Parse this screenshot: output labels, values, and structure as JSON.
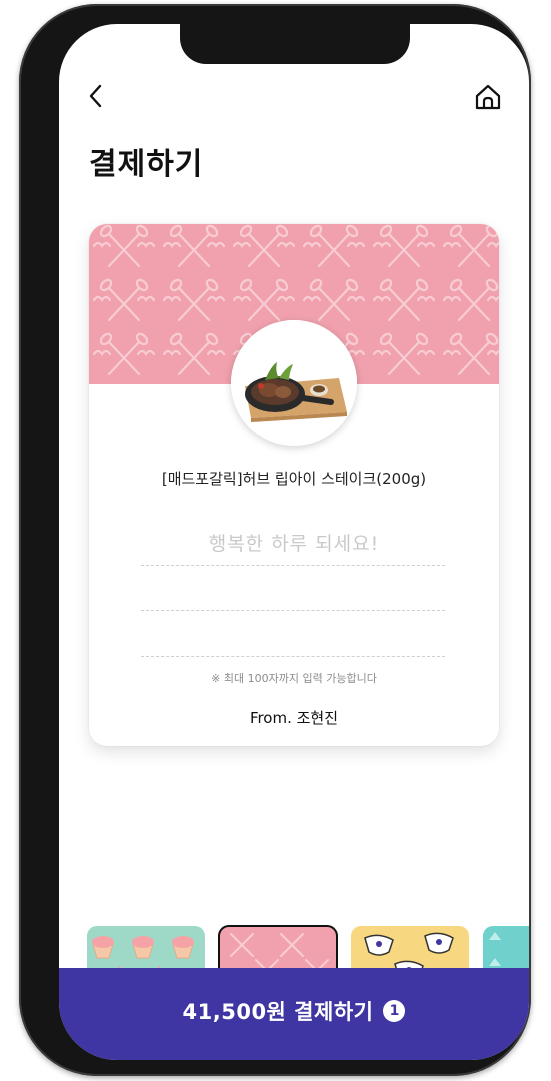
{
  "header": {
    "back_icon": "chevron-left-icon",
    "home_icon": "home-icon"
  },
  "page": {
    "title": "결제하기"
  },
  "card": {
    "theme_color": "#f0a1ad",
    "pattern_color": "#f7c7cf",
    "product_name": "[매드포갈릭]허브 립아이 스테이크(200g)",
    "message_placeholder": "행복한 하루 되세요!",
    "limit_note": "※ 최대 100자까지 입력 가능합니다",
    "from_label": "From. 조현진"
  },
  "themes": [
    {
      "name": "cupcake",
      "color": "#9ed9c7",
      "selected": false
    },
    {
      "name": "pink-whisk",
      "color": "#f0a1ad",
      "selected": true
    },
    {
      "name": "yellow-cup",
      "color": "#f7d77f",
      "selected": false
    },
    {
      "name": "teal-pattern",
      "color": "#6fd0cc",
      "selected": false
    }
  ],
  "pay_button": {
    "label": "41,500원 결제하기",
    "badge": "1",
    "color": "#3f35a3"
  }
}
